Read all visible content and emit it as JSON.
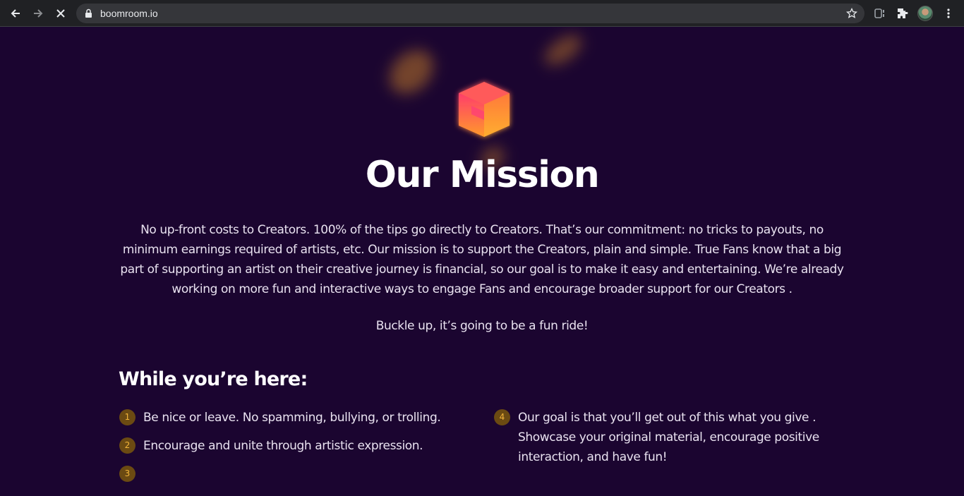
{
  "browser": {
    "url": "boomroom.io",
    "back_icon": "back-arrow-icon",
    "forward_icon": "forward-arrow-icon",
    "stop_icon": "stop-loading-icon"
  },
  "page": {
    "title": "Our Mission",
    "mission_text": "No up-front costs to Creators. 100% of the tips go directly to Creators. That’s our commitment: no tricks to payouts, no minimum earnings required of artists, etc. Our mission is to support the Creators, plain and simple. True Fans know that a big part of supporting an artist on their creative journey is financial, so our goal is to make it easy and entertaining. We’re already working on more fun and interactive ways to engage Fans and encourage broader support for our Creators .",
    "tagline": "Buckle up, it’s going to be a fun ride!",
    "here_title": "While you’re here:",
    "rules": [
      {
        "num": "1",
        "text": "Be nice or leave. No spamming, bullying, or trolling."
      },
      {
        "num": "2",
        "text": "Encourage and unite through artistic expression."
      },
      {
        "num": "3",
        "text": ""
      },
      {
        "num": "4",
        "text": "Our goal is that you’ll get out of this what you give . Showcase your original material, encourage positive interaction, and have fun!"
      }
    ]
  },
  "colors": {
    "background": "#1b0530",
    "badge": "#6b4a12",
    "badge_text": "#f2b43a"
  }
}
